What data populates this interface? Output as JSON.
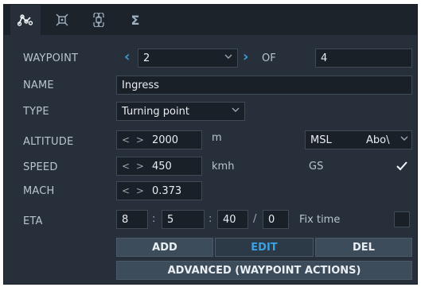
{
  "tabs": [
    {
      "icon": "route-icon",
      "active": true
    },
    {
      "icon": "target-icon",
      "active": false
    },
    {
      "icon": "command-icon",
      "active": false
    },
    {
      "icon": "sigma-icon",
      "glyph": "Σ",
      "active": false
    }
  ],
  "waypoint": {
    "label": "WAYPOINT",
    "value": "2",
    "of_label": "OF",
    "total": "4"
  },
  "name": {
    "label": "NAME",
    "value": "Ingress"
  },
  "type": {
    "label": "TYPE",
    "value": "Turning point"
  },
  "altitude": {
    "label": "ALTITUDE",
    "arrows": "< >",
    "value": "2000",
    "unit": "m",
    "ref": "MSL",
    "ref_mode": "Abo\\"
  },
  "speed": {
    "label": "SPEED",
    "arrows": "< >",
    "value": "450",
    "unit": "kmh",
    "mode": "GS",
    "mode_checked": true
  },
  "mach": {
    "label": "MACH",
    "arrows": "< >",
    "value": "0.373"
  },
  "eta": {
    "label": "ETA",
    "h": "8",
    "m": "5",
    "s": "40",
    "sep1": ":",
    "sep2": ":",
    "sep3": "/",
    "frac": "0",
    "fix_label": "Fix time",
    "fix_checked": false
  },
  "buttons": {
    "add": "ADD",
    "edit": "EDIT",
    "del": "DEL",
    "advanced": "ADVANCED (WAYPOINT ACTIONS)"
  },
  "colors": {
    "accent": "#3a9bd8",
    "panel": "#27303a",
    "field": "#1a2027",
    "button": "#3d4c5a"
  }
}
